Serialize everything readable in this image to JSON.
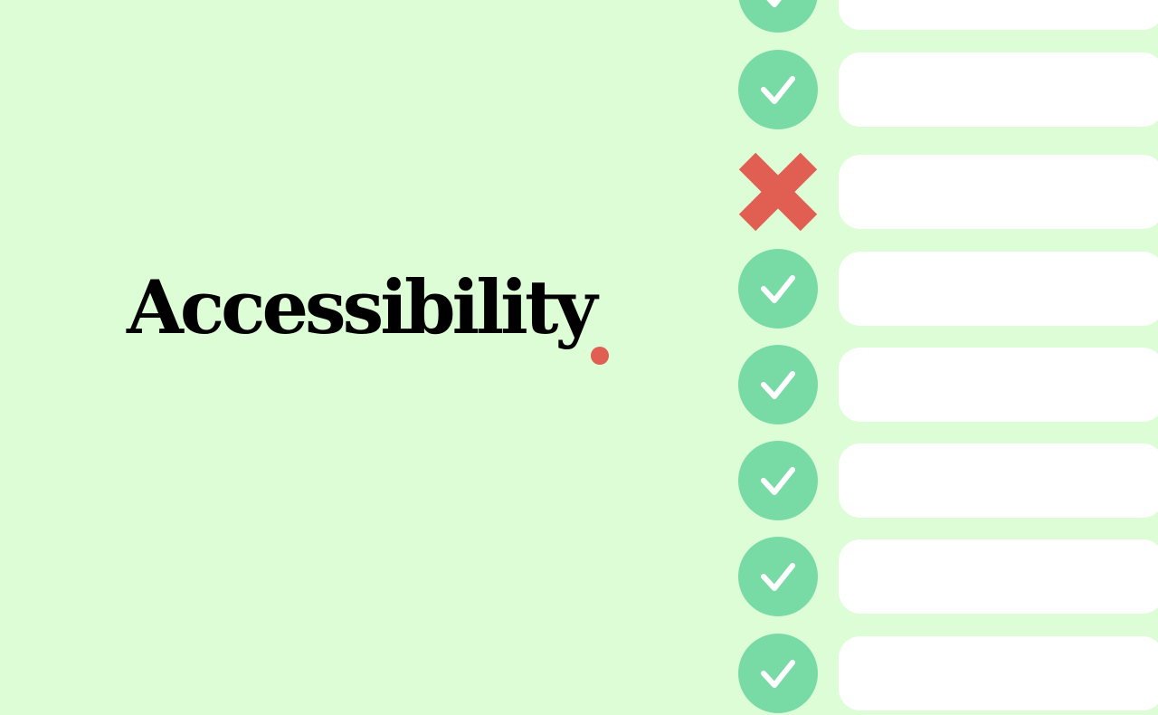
{
  "headline": {
    "text": "Accessibility",
    "accent_color": "#e05e52"
  },
  "colors": {
    "background": "#ddfdd7",
    "pass": "#78dba6",
    "fail": "#e05e52",
    "field": "#ffffff",
    "text": "#000000"
  },
  "checklist": {
    "items": [
      {
        "status": "pass",
        "icon": "check-icon"
      },
      {
        "status": "pass",
        "icon": "check-icon"
      },
      {
        "status": "fail",
        "icon": "cross-icon"
      },
      {
        "status": "pass",
        "icon": "check-icon"
      },
      {
        "status": "pass",
        "icon": "check-icon"
      },
      {
        "status": "pass",
        "icon": "check-icon"
      },
      {
        "status": "pass",
        "icon": "check-icon"
      },
      {
        "status": "pass",
        "icon": "check-icon"
      }
    ]
  }
}
